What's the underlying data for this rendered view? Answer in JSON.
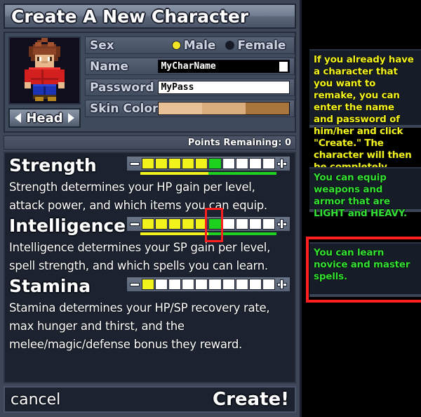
{
  "window": {
    "title": "Create A New Character"
  },
  "avatar": {
    "head_selector_label": "Head",
    "prev_icon": "arrow-left-icon",
    "next_icon": "arrow-right-icon"
  },
  "form": {
    "sex": {
      "label": "Sex",
      "options": [
        {
          "label": "Male",
          "selected": true
        },
        {
          "label": "Female",
          "selected": false
        }
      ]
    },
    "name": {
      "label": "Name",
      "value": "MyCharName",
      "placeholder": "",
      "focused": true
    },
    "password": {
      "label": "Password",
      "value": "MyPass",
      "placeholder": "",
      "focused": false
    },
    "skin_color": {
      "label": "Skin Color",
      "bands": [
        "#e8c196",
        "#d9ad7e",
        "#a8763c"
      ]
    }
  },
  "points": {
    "label": "Points Remaining: 0",
    "remaining": 0
  },
  "stats": [
    {
      "name": "Strength",
      "description": "Strength determines your HP gain per level, attack power, and which items you can equip.",
      "total_segments": 10,
      "yellow": 5,
      "green": 1,
      "white": 4,
      "underline": true,
      "highlighted": false,
      "minus_label": "-",
      "plus_label": "+"
    },
    {
      "name": "Intelligence",
      "description": "Intelligence determines your SP gain per level, spell strength, and which spells you can learn.",
      "total_segments": 10,
      "yellow": 5,
      "green": 1,
      "white": 4,
      "underline": true,
      "highlighted": true,
      "minus_label": "-",
      "plus_label": "+"
    },
    {
      "name": "Stamina",
      "description": "Stamina determines your HP/SP recovery rate, max hunger and thirst, and the melee/magic/defense bonus they reward.",
      "total_segments": 10,
      "yellow": 1,
      "green": 0,
      "white": 9,
      "underline": false,
      "highlighted": false,
      "minus_label": "-",
      "plus_label": "+"
    }
  ],
  "footer": {
    "cancel_label": "cancel",
    "create_label": "Create!"
  },
  "tooltips": [
    {
      "text": "If you already have a character that you want to remake, you can enter the name and password of him/her and click \"Create.\" The character will then be completely reset.",
      "color": "#f2f21c",
      "highlighted": false
    },
    {
      "text": "You can equip weapons and armor that are LIGHT and HEAVY.",
      "color": "#33e033",
      "highlighted": false
    },
    {
      "text": "You can learn novice and master spells.",
      "color": "#33e033",
      "highlighted": true
    }
  ],
  "colors": {
    "yellow_segment": "#f2f21c",
    "green_segment": "#1ed11e",
    "white_segment": "#ffffff",
    "highlight_border": "#ff1f1f",
    "panel_bg": "#3f4a5c",
    "stats_bg": "#1c2230"
  }
}
